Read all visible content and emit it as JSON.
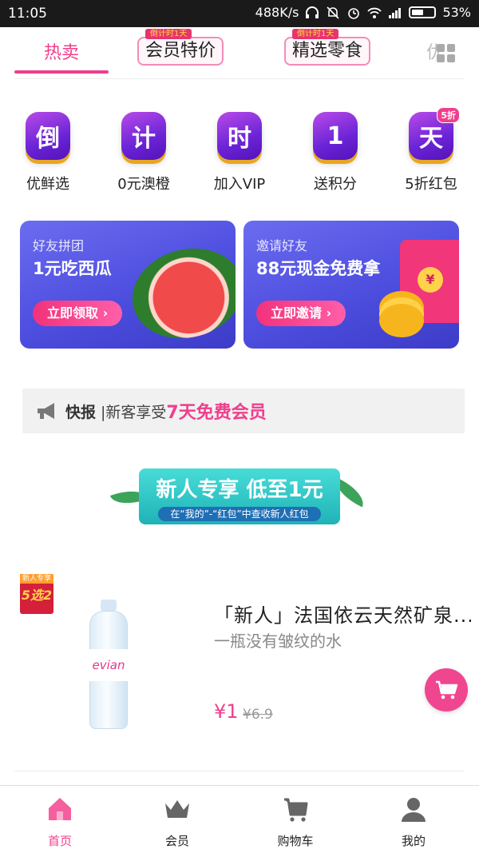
{
  "status": {
    "time": "11:05",
    "speed": "488K/s",
    "battery": "53%",
    "battery_level": 0.53
  },
  "tabs": [
    {
      "label": "热卖",
      "ribbon": ""
    },
    {
      "label": "会员特价",
      "ribbon": "倒计时1天"
    },
    {
      "label": "精选零食",
      "ribbon": "倒计时1天"
    },
    {
      "label": "优",
      "ribbon": ""
    }
  ],
  "categories": [
    {
      "glyph": "倒",
      "label": "优鲜选",
      "badge": ""
    },
    {
      "glyph": "计",
      "label": "0元澳橙",
      "badge": ""
    },
    {
      "glyph": "时",
      "label": "加入VIP",
      "badge": ""
    },
    {
      "glyph": "1",
      "label": "送积分",
      "badge": ""
    },
    {
      "glyph": "天",
      "label": "5折红包",
      "badge": "5折"
    }
  ],
  "banners": [
    {
      "sub": "好友拼团",
      "title": "1元吃西瓜",
      "button": "立即领取 ›"
    },
    {
      "sub": "邀请好友",
      "title": "88元现金免费拿",
      "button": "立即邀请 ›",
      "seal": "¥"
    }
  ],
  "news": {
    "key": "快报",
    "text": "|新客享受",
    "highlight": "7天免费会员"
  },
  "newbie": {
    "title": "新人专享 低至1元",
    "subtitle": "在“我的”-“红包”中查收新人红包"
  },
  "product": {
    "tag_top": "新人专享",
    "tag_main": "5选2",
    "brand": "evian",
    "title": "「新人」法国依云天然矿泉...",
    "subtitle": "一瓶没有皱纹的水",
    "price": "¥1",
    "old_price": "¥6.9"
  },
  "nav": [
    {
      "label": "首页",
      "icon": "home-icon",
      "active": true
    },
    {
      "label": "会员",
      "icon": "crown-icon",
      "active": false
    },
    {
      "label": "购物车",
      "icon": "cart-icon",
      "active": false
    },
    {
      "label": "我的",
      "icon": "user-icon",
      "active": false
    }
  ],
  "colors": {
    "accent": "#ef3f8c",
    "icon_purple": "#6a23d6",
    "banner_blue": "#4e4edf",
    "teal": "#1eb3b6"
  }
}
